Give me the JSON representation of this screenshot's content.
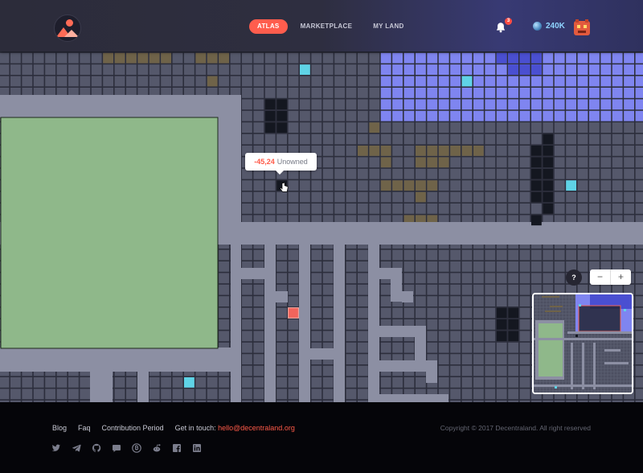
{
  "header": {
    "tabs": [
      {
        "label": "ATLAS",
        "active": true
      },
      {
        "label": "MARKETPLACE",
        "active": false
      },
      {
        "label": "MY LAND",
        "active": false
      }
    ],
    "notification_count": "3",
    "balance": "240K"
  },
  "tooltip": {
    "coords": "-45,24",
    "owner": "Unowned"
  },
  "map_controls": {
    "help_label": "?",
    "zoom_out_label": "−",
    "zoom_in_label": "+"
  },
  "footer": {
    "links": [
      "Blog",
      "Faq",
      "Contribution Period"
    ],
    "contact_label": "Get in touch:",
    "contact_email": "hello@decentraland.org",
    "copyright": "Copyright © 2017 Decentraland. All right reserved",
    "social_icons": [
      "twitter-icon",
      "telegram-icon",
      "github-icon",
      "chat-icon",
      "bitcoin-icon",
      "reddit-icon",
      "facebook-icon",
      "linkedin-icon"
    ]
  },
  "colors": {
    "accent": "#ff5d4d",
    "parcel": "#55586b",
    "road": "#8c8fa3",
    "plaza": "#8fb88a",
    "district": "#7f85f0",
    "district_dark": "#4a4fd1",
    "contribution": "#6f6349",
    "taken": "#141720",
    "highlight": "#5fd3e6",
    "selected": "#f1655c"
  }
}
